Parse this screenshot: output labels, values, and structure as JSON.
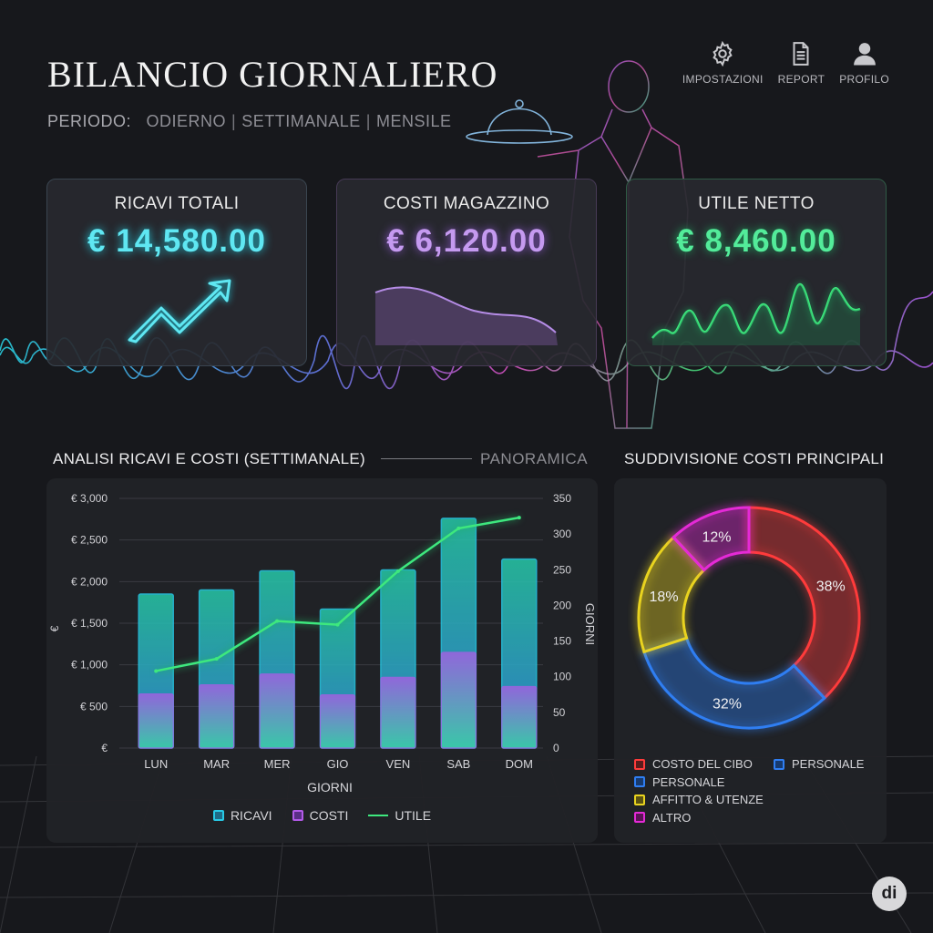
{
  "header": {
    "title": "BILANCIO GIORNALIERO",
    "period_label": "PERIODO:",
    "period_options": [
      "ODIERNO",
      "SETTIMANALE",
      "MENSILE"
    ]
  },
  "toolbar": {
    "items": [
      {
        "label": "IMPOSTAZIONI",
        "icon": "gear-icon"
      },
      {
        "label": "REPORT",
        "icon": "document-icon"
      },
      {
        "label": "PROFILO",
        "icon": "user-icon"
      }
    ]
  },
  "kpis": [
    {
      "title": "RICAVI TOTALI",
      "value": "€ 14,580.00",
      "color": "#5fe7f2",
      "trend_icon": "trend-up-arrow-icon"
    },
    {
      "title": "COSTI MAGAZZINO",
      "value": "€ 6,120.00",
      "color": "#c59af0",
      "trend_icon": "declining-area-icon"
    },
    {
      "title": "UTILE NETTO",
      "value": "€ 8,460.00",
      "color": "#53ec9a",
      "trend_icon": "wave-line-icon"
    }
  ],
  "bar_section": {
    "title": "ANALISI RICAVI E COSTI (SETTIMANALE)",
    "subtitle": "PANORAMICA"
  },
  "donut_section": {
    "title": "SUDDIVISIONE COSTI PRINCIPALI"
  },
  "chart_data": [
    {
      "type": "bar",
      "categories": [
        "LUN",
        "MAR",
        "MER",
        "GIO",
        "VEN",
        "SAB",
        "DOM"
      ],
      "xlabel": "GIORNI",
      "ylabel": "€",
      "y2label": "GIORNI",
      "ylim": [
        0,
        3000
      ],
      "y2lim": [
        0,
        350
      ],
      "y_ticks": [
        "€",
        "€ 500",
        "€ 1,000",
        "€ 1,500",
        "€ 2,000",
        "€ 2,500",
        "€ 3,000"
      ],
      "y2_ticks": [
        "0",
        "50",
        "100",
        "150",
        "200",
        "250",
        "300",
        "350"
      ],
      "series": [
        {
          "name": "RICAVI",
          "type": "bar",
          "color": "#27c9e6",
          "values": [
            1850,
            1900,
            2130,
            1670,
            2140,
            2760,
            2270
          ]
        },
        {
          "name": "COSTI",
          "type": "bar",
          "color": "#b25ae8",
          "values": [
            650,
            760,
            890,
            640,
            850,
            1150,
            740
          ]
        },
        {
          "name": "UTILE",
          "type": "line",
          "axis": "right",
          "color": "#3ee87e",
          "values": [
            108,
            125,
            178,
            173,
            248,
            308,
            323
          ]
        }
      ],
      "legend_position": "bottom",
      "grid": true
    },
    {
      "type": "pie",
      "subtype": "donut",
      "labels": [
        "COSTO DEL CIBO",
        "PERSONALE",
        "AFFITTO & UTENZE",
        "ALTRO"
      ],
      "values": [
        38,
        32,
        18,
        12
      ],
      "value_labels": [
        "38%",
        "32%",
        "18%",
        "12%"
      ],
      "colors": [
        "#ff3b3b",
        "#2f7ef2",
        "#e9d31f",
        "#e42ad6"
      ],
      "legend_extra": "PERSONALE",
      "legend_position": "bottom"
    }
  ],
  "brand": {
    "logo_text": "di"
  }
}
